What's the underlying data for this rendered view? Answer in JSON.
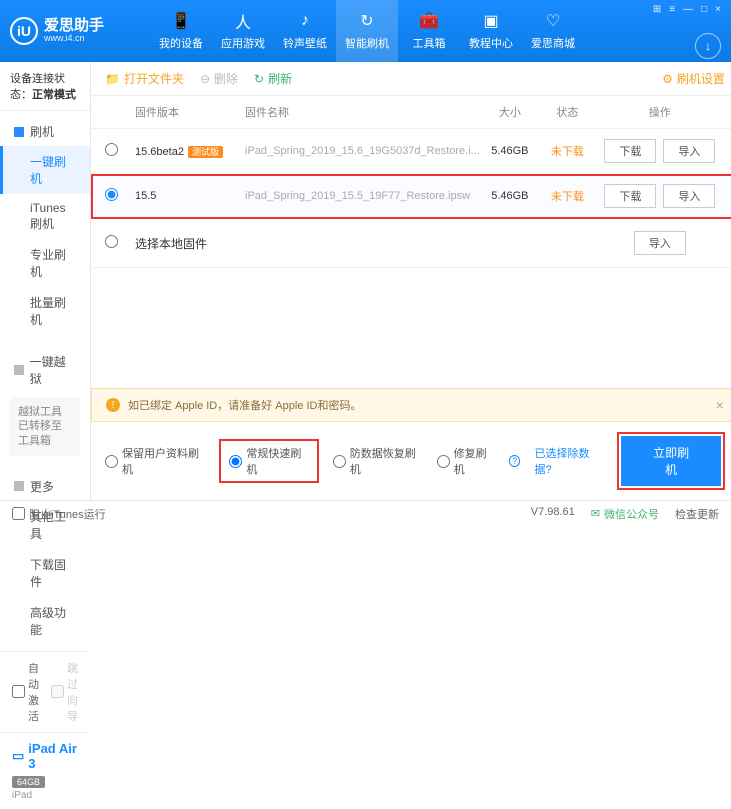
{
  "header": {
    "logo_letter": "iU",
    "app_name": "爱思助手",
    "site": "www.i4.cn",
    "nav": [
      {
        "label": "我的设备"
      },
      {
        "label": "应用游戏"
      },
      {
        "label": "铃声壁纸"
      },
      {
        "label": "智能刷机"
      },
      {
        "label": "工具箱"
      },
      {
        "label": "教程中心"
      },
      {
        "label": "爱思商城"
      }
    ],
    "win": {
      "grid": "⊞",
      "menu": "≡",
      "min": "—",
      "max": "□",
      "close": "×",
      "arrow": "↓"
    }
  },
  "sidebar": {
    "status_label": "设备连接状态：",
    "status_value": "正常模式",
    "sec1": {
      "title": "刷机",
      "items": [
        "一键刷机",
        "iTunes刷机",
        "专业刷机",
        "批量刷机"
      ]
    },
    "sec2": {
      "title": "一键越狱",
      "note": "越狱工具已转移至工具箱"
    },
    "sec3": {
      "title": "更多",
      "items": [
        "其他工具",
        "下载固件",
        "高级功能"
      ]
    },
    "checks": {
      "auto_activate": "自动激活",
      "skip_guide": "跳过向导"
    },
    "device": {
      "icon": "▭",
      "name": "iPad Air 3",
      "storage": "64GB",
      "type": "iPad"
    }
  },
  "toolbar": {
    "open_folder": "打开文件夹",
    "delete": "删除",
    "refresh": "刷新",
    "settings": "刷机设置"
  },
  "table": {
    "headers": {
      "version": "固件版本",
      "name": "固件名称",
      "size": "大小",
      "status": "状态",
      "ops": "操作"
    },
    "rows": [
      {
        "version": "15.6beta2",
        "beta_tag": "测试版",
        "name": "iPad_Spring_2019_15.6_19G5037d_Restore.i...",
        "size": "5.46GB",
        "status": "未下载",
        "selected": false
      },
      {
        "version": "15.5",
        "name": "iPad_Spring_2019_15.5_19F77_Restore.ipsw",
        "size": "5.46GB",
        "status": "未下载",
        "selected": true
      }
    ],
    "local_row": "选择本地固件",
    "btn_download": "下载",
    "btn_import": "导入"
  },
  "notice": {
    "text": "如已绑定 Apple ID，请准备好 Apple ID和密码。"
  },
  "options": {
    "opt1": "保留用户资料刷机",
    "opt2": "常规快速刷机",
    "opt3": "防数据恢复刷机",
    "opt4": "修复刷机",
    "exclude_link": "已选择除数据?",
    "flash_now": "立即刷机"
  },
  "footer": {
    "block_itunes": "阻止iTunes运行",
    "version": "V7.98.61",
    "wechat": "微信公众号",
    "check_update": "检查更新"
  }
}
